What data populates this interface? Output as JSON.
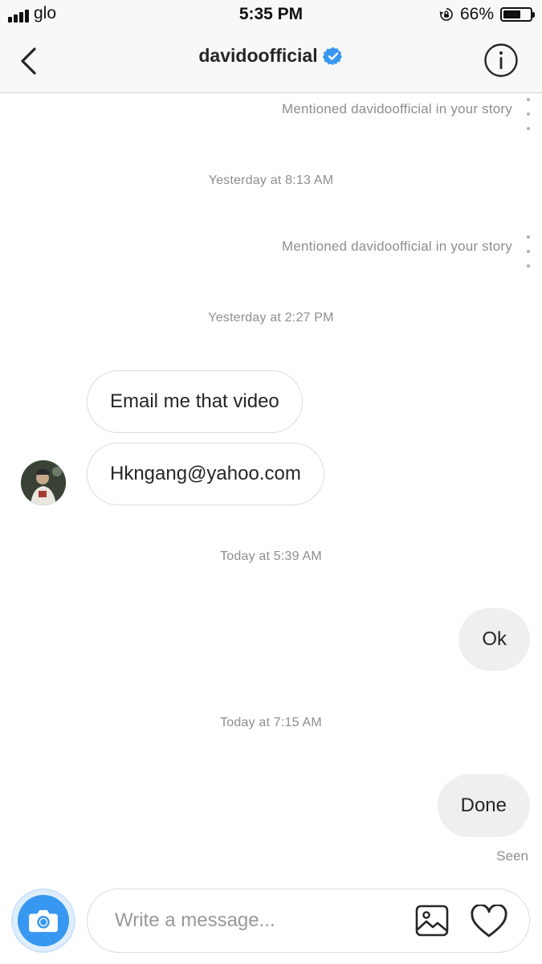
{
  "status_bar": {
    "carrier": "glo",
    "time": "5:35 PM",
    "battery_percent": "66%",
    "battery_level": 0.66
  },
  "header": {
    "title": "davidoofficial",
    "verified": true,
    "back_icon": "chevron-left-icon",
    "info_icon": "info-icon"
  },
  "messages": [
    {
      "type": "story_mention",
      "text": "Mentioned davidoofficial in your story"
    },
    {
      "type": "timestamp",
      "text": "Yesterday at 8:13 AM"
    },
    {
      "type": "story_mention",
      "text": "Mentioned davidoofficial in your story"
    },
    {
      "type": "timestamp",
      "text": "Yesterday at 2:27 PM"
    },
    {
      "type": "incoming",
      "text": "Email me that video"
    },
    {
      "type": "incoming",
      "text": "Hkngang@yahoo.com"
    },
    {
      "type": "timestamp",
      "text": "Today at 5:39 AM"
    },
    {
      "type": "outgoing",
      "text": "Ok"
    },
    {
      "type": "timestamp",
      "text": "Today at 7:15 AM"
    },
    {
      "type": "outgoing",
      "text": "Done"
    }
  ],
  "seen_label": "Seen",
  "composer": {
    "placeholder": "Write a message...",
    "camera_icon": "camera-icon",
    "gallery_icon": "gallery-icon",
    "heart_icon": "heart-icon"
  },
  "colors": {
    "accent_blue": "#3897f0",
    "outgoing_bubble": "#efefef",
    "muted_text": "#8e8e8e",
    "border": "#dbdbdb"
  }
}
